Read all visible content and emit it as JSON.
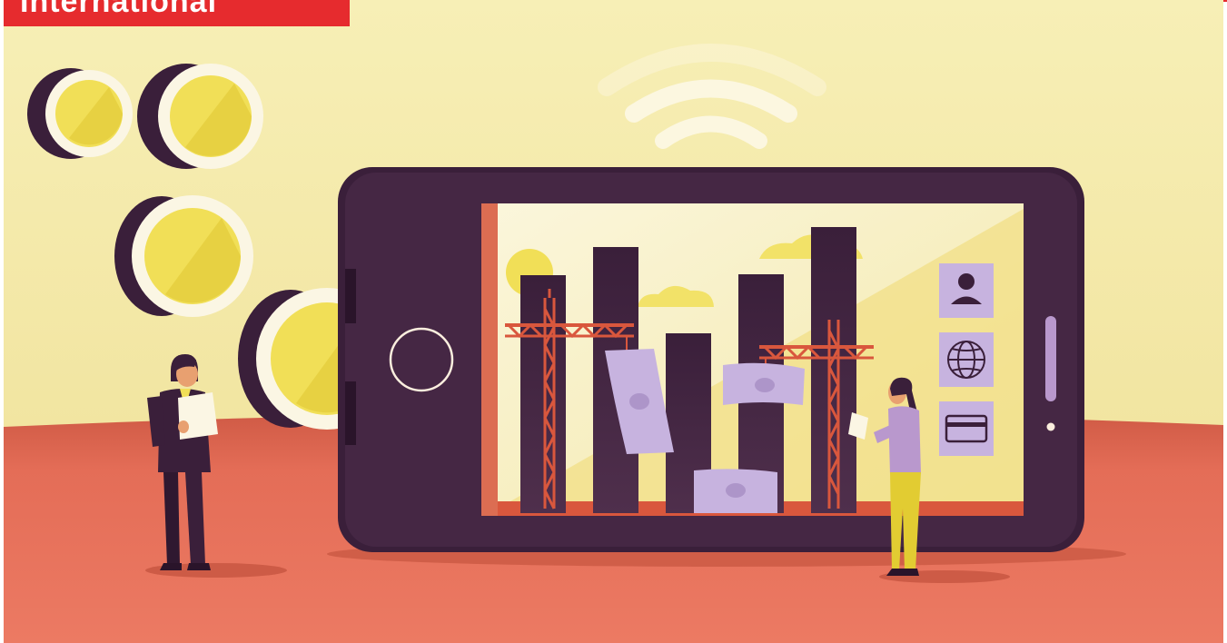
{
  "section_label": "International",
  "colors": {
    "brand_red": "#e62b2e",
    "sky": "#f4e9a6",
    "ground": "#e8735e",
    "phone_body": "#3a1f3a",
    "coin_yellow": "#f1df57",
    "banknote": "#c7b3df",
    "crane": "#d9573d"
  },
  "icons": [
    "wifi-icon",
    "user-icon",
    "globe-icon",
    "credit-card-icon"
  ]
}
